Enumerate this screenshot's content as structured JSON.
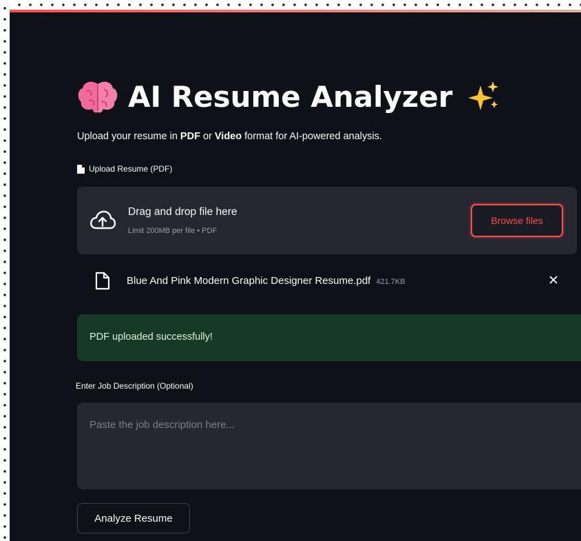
{
  "header": {
    "title": "AI Resume Analyzer",
    "title_icon_left": "brain-icon",
    "title_icon_right": "sparkles-icon",
    "accent_color": "#ff4b4b"
  },
  "intro": {
    "prefix": "Upload your resume in ",
    "pdf": "PDF",
    "middle": " or ",
    "video": "Video",
    "suffix": " format for AI-powered analysis."
  },
  "uploader": {
    "label_icon": "document-icon",
    "label": "Upload Resume (PDF)",
    "drop_icon": "cloud-upload-icon",
    "drop_text": "Drag and drop file here",
    "limit_text": "Limit 200MB per file • PDF",
    "browse_label": "Browse files"
  },
  "uploaded_file": {
    "icon": "file-icon",
    "name": "Blue And Pink Modern Graphic Designer Resume.pdf",
    "size": "421.7KB",
    "remove_icon": "close-icon"
  },
  "alert": {
    "text": "PDF uploaded successfully!",
    "color": "#173928"
  },
  "job_description": {
    "label": "Enter Job Description (Optional)",
    "placeholder": "Paste the job description here...",
    "value": ""
  },
  "actions": {
    "analyze_label": "Analyze Resume"
  }
}
